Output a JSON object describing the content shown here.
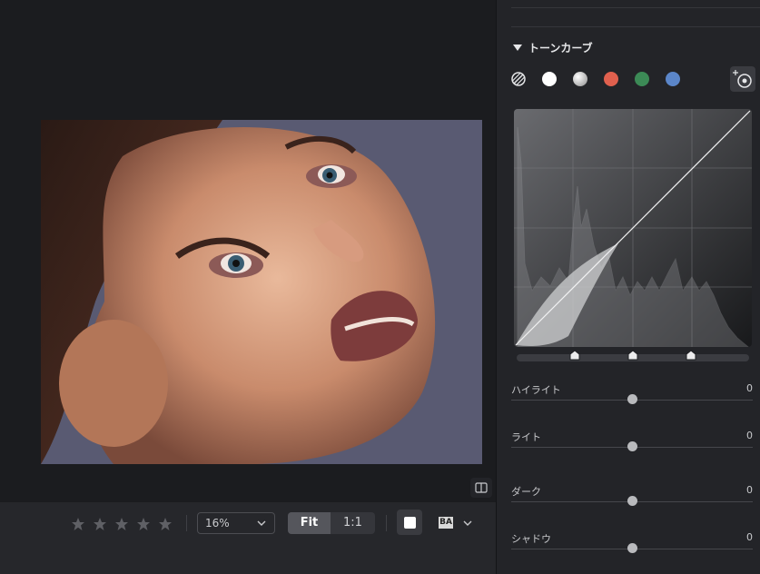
{
  "toolbar": {
    "stars": [
      "☆",
      "☆",
      "☆",
      "☆",
      "☆"
    ],
    "zoom_value": "16%",
    "fit_label": "Fit",
    "one_to_one_label": "1:1",
    "before_after_label": "BA"
  },
  "panel": {
    "section_title": "トーンカーブ",
    "channels": [
      {
        "name": "luminosity",
        "color": "#ffffff"
      },
      {
        "name": "rgb",
        "color": "#d8d8d8"
      },
      {
        "name": "red",
        "color": "#e0604e"
      },
      {
        "name": "green",
        "color": "#3c8a56"
      },
      {
        "name": "blue",
        "color": "#5b86c9"
      }
    ],
    "sliders": [
      {
        "label": "ハイライト",
        "value": "0"
      },
      {
        "label": "ライト",
        "value": "0"
      },
      {
        "label": "ダーク",
        "value": "0"
      },
      {
        "label": "シャドウ",
        "value": "0"
      }
    ]
  }
}
